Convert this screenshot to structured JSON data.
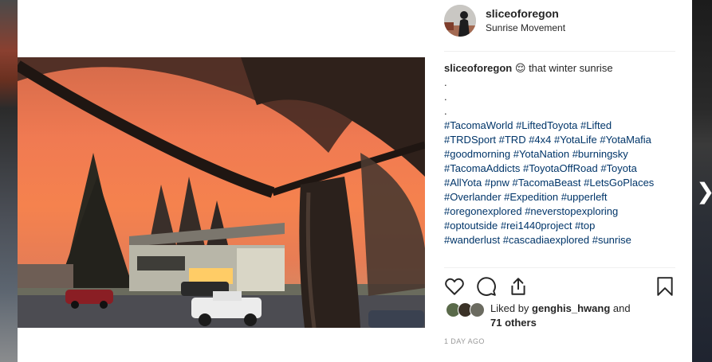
{
  "post": {
    "username": "sliceoforegon",
    "location": "Sunrise Movement",
    "caption": {
      "user": "sliceoforegon",
      "emoji": "😌",
      "text": "that winter sunrise",
      "dots": [
        ".",
        ".",
        "."
      ],
      "hashtags": [
        "#TacomaWorld #LiftedToyota #Lifted",
        "#TRDSport #TRD #4x4 #YotaLife #YotaMafia",
        "#goodmorning #YotaNation #burningsky",
        "#TacomaAddicts #ToyotaOffRoad #Toyota",
        "#AllYota #pnw #TacomaBeast #LetsGoPlaces",
        "#Overlander #Expedition #upperleft",
        "#oregonexplored #neverstopexploring",
        "#optoutside #rei1440project #top",
        "#wanderlust #cascadiaexplored #sunrise"
      ]
    },
    "likes": {
      "prefix": "Liked by",
      "liker": "genghis_hwang",
      "and": "and",
      "others": "71 others"
    },
    "timestamp": "1 DAY AGO"
  },
  "icons": {
    "like": "heart-icon",
    "comment": "comment-bubble-icon",
    "share": "share-icon",
    "save": "bookmark-icon",
    "next": "chevron-right-icon"
  },
  "next_glyph": "❯",
  "colors": {
    "hashtag": "#003569",
    "text": "#262626",
    "muted": "#999999"
  }
}
